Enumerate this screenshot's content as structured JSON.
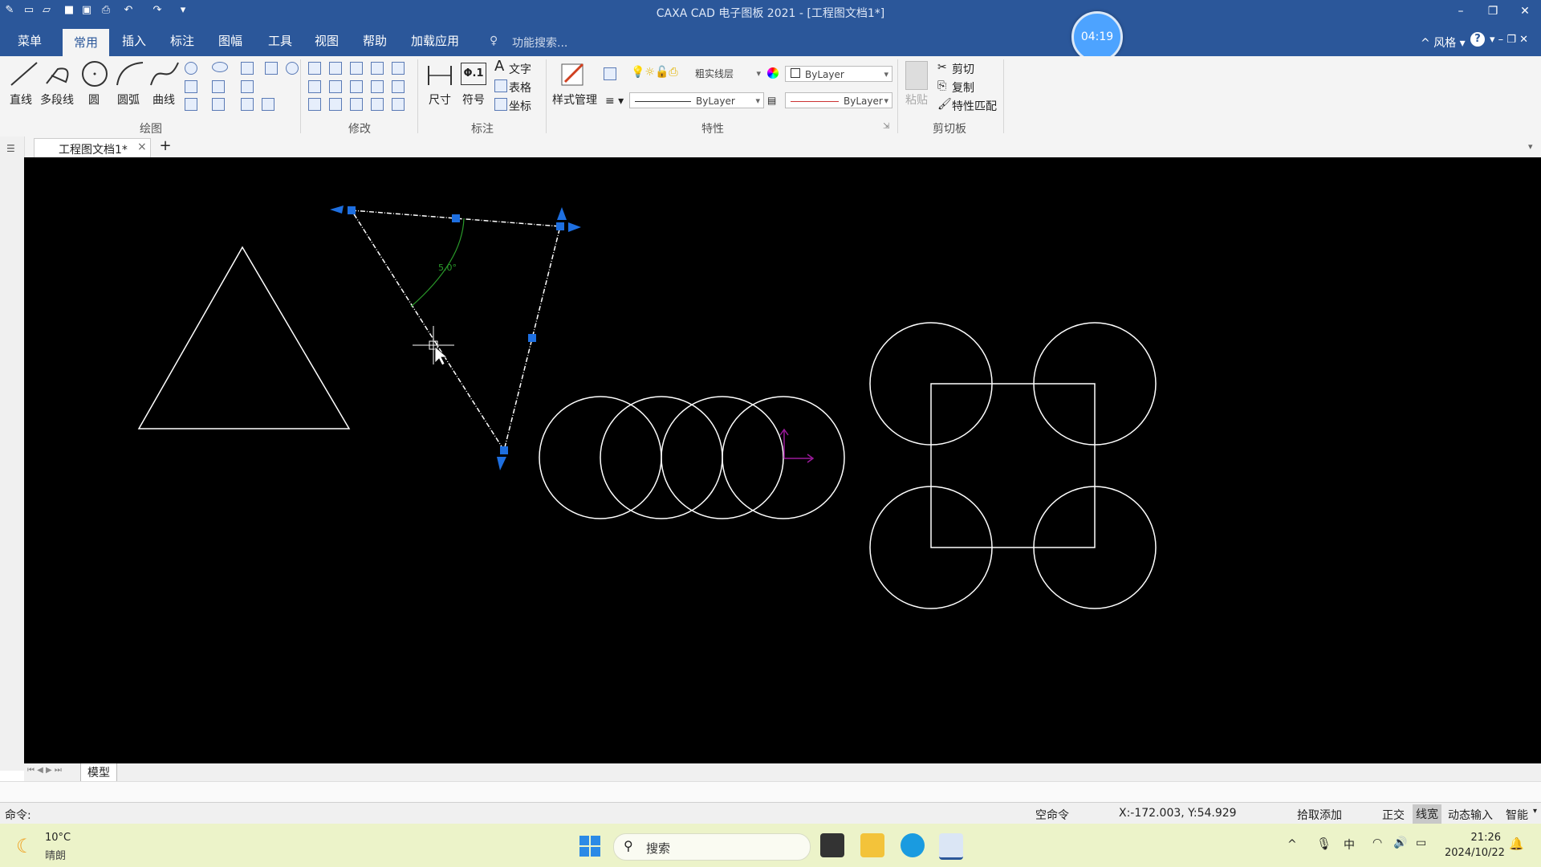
{
  "window": {
    "title": "CAXA CAD 电子图板 2021 - [工程图文档1*]"
  },
  "timer": "04:19",
  "menu": {
    "items": [
      "菜单",
      "常用",
      "插入",
      "标注",
      "图幅",
      "工具",
      "视图",
      "帮助",
      "加载应用"
    ],
    "active": "常用",
    "search_placeholder": "功能搜索...",
    "style_label": "风格"
  },
  "ribbon": {
    "draw": {
      "label": "绘图",
      "tools": [
        "直线",
        "多段线",
        "圆",
        "圆弧",
        "曲线"
      ]
    },
    "modify": {
      "label": "修改"
    },
    "annotate": {
      "label": "标注",
      "tools": [
        "尺寸",
        "符号"
      ],
      "text": "文字",
      "table": "表格",
      "coord": "坐标"
    },
    "properties": {
      "label": "特性",
      "style_manager": "样式管理",
      "layer": "粗实线层",
      "color": "ByLayer",
      "linetype": "ByLayer",
      "lineweight": "ByLayer"
    },
    "clipboard": {
      "label": "剪切板",
      "paste": "粘贴",
      "cut": "剪切",
      "copy": "复制",
      "match": "特性匹配"
    }
  },
  "doc_tab": {
    "label": "工程图文档1*",
    "add": "+"
  },
  "canvas": {
    "angle_readout": "5.0°"
  },
  "model_tab": "模型",
  "command": {
    "prompt": "命令:"
  },
  "status": {
    "mode": "空命令",
    "coords": "X:-172.003, Y:54.929",
    "pick": "拾取添加",
    "ortho": "正交",
    "linewidth": "线宽",
    "dynamic": "动态输入",
    "smart": "智能"
  },
  "taskbar": {
    "weather_temp": "10°C",
    "weather_desc": "晴朗",
    "search": "搜索",
    "time": "21:26",
    "date": "2024/10/22"
  },
  "colors": {
    "accent": "#2b579a",
    "grip": "#1e6fe0",
    "canvas": "#000000"
  }
}
